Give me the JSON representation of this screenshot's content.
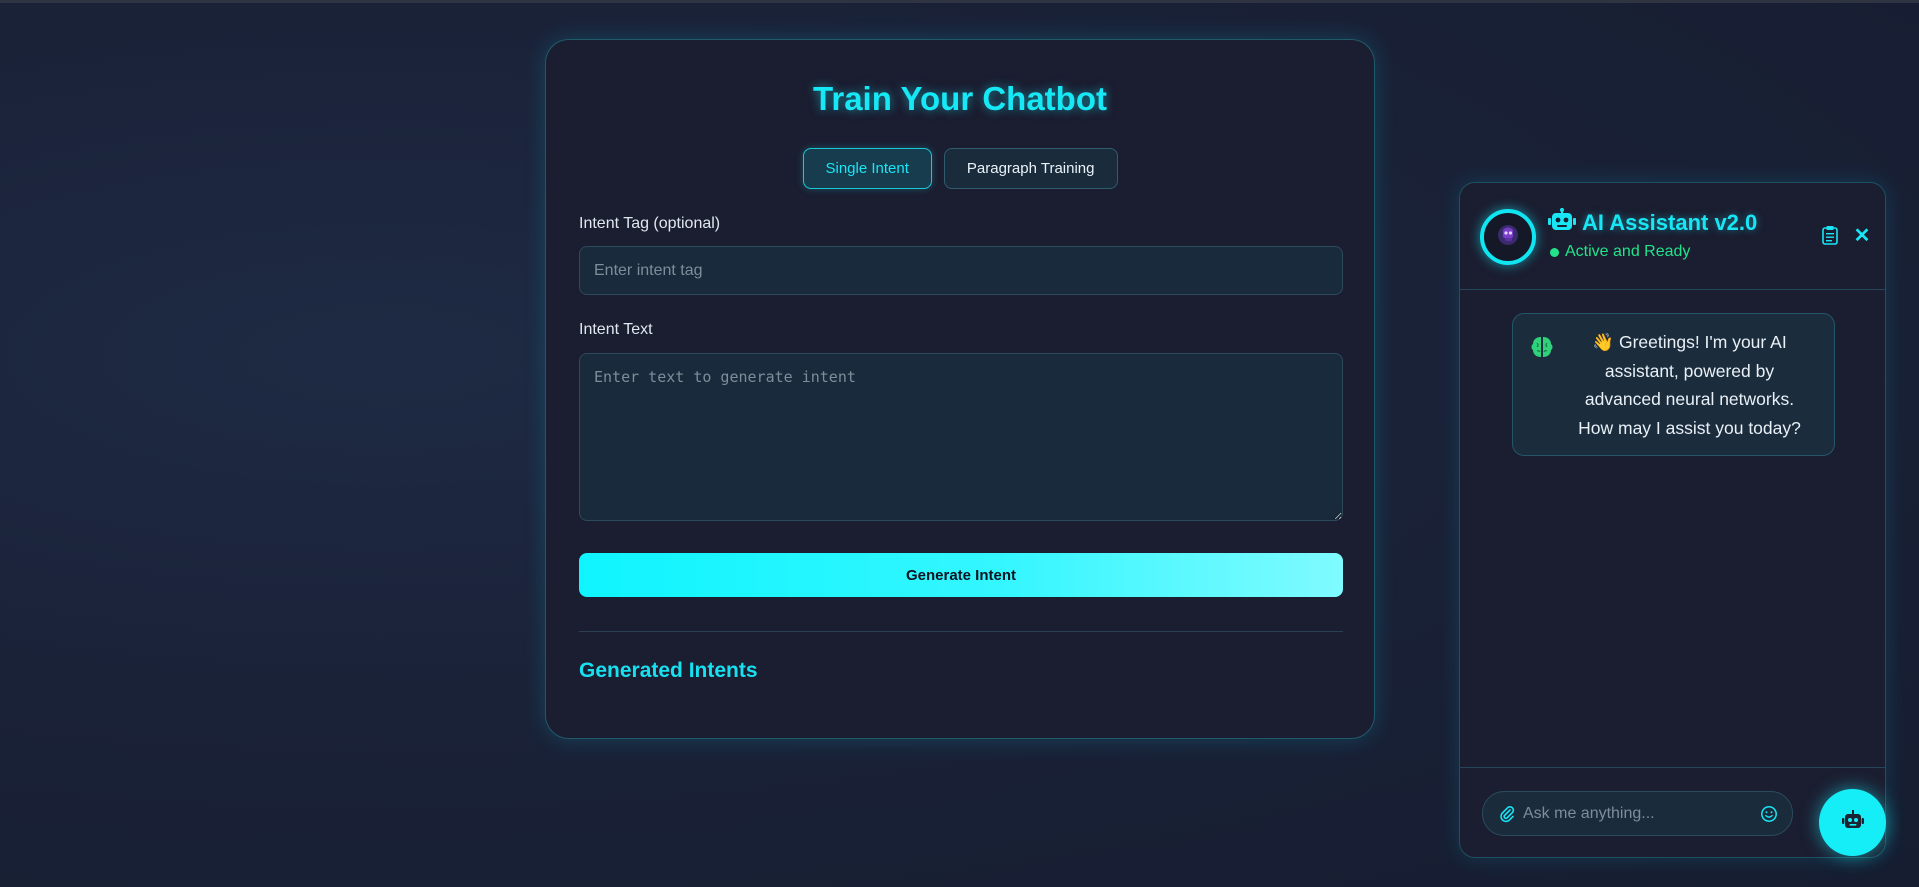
{
  "training": {
    "title": "Train Your Chatbot",
    "tabs": [
      {
        "label": "Single Intent",
        "active": true
      },
      {
        "label": "Paragraph Training",
        "active": false
      }
    ],
    "intent_tag_label": "Intent Tag (optional)",
    "intent_tag_placeholder": "Enter intent tag",
    "intent_tag_value": "",
    "intent_text_label": "Intent Text",
    "intent_text_placeholder": "Enter text to generate intent",
    "intent_text_value": "",
    "generate_label": "Generate Intent",
    "generated_title": "Generated Intents"
  },
  "chat": {
    "title": "AI Assistant v2.0",
    "status": "Active and Ready",
    "welcome_message": "👋 Greetings! I'm your AI assistant, powered by advanced neural networks. How may I assist you today?",
    "input_placeholder": "Ask me anything..."
  },
  "icons": {
    "title_icon": "robot-icon",
    "avatar": "robot-head-icon",
    "clear": "clipboard-icon",
    "close": "close-icon",
    "message_icon": "brain-icon",
    "attach": "paperclip-icon",
    "emoji": "smile-icon",
    "fab": "robot-icon"
  },
  "colors": {
    "accent": "#17e8f5",
    "status": "#22e38a",
    "background": "#1a2238",
    "card": "#1b1d30"
  }
}
